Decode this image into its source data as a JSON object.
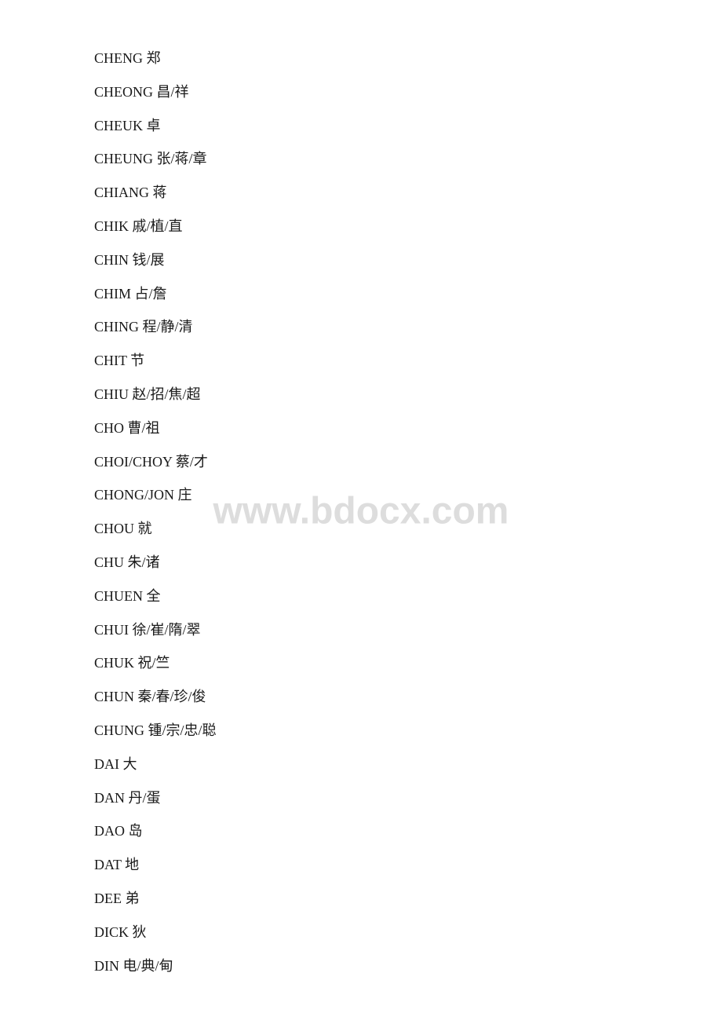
{
  "watermark": "www.bdocx.com",
  "entries": [
    {
      "id": "cheng",
      "text": "CHENG 郑"
    },
    {
      "id": "cheong",
      "text": "CHEONG 昌/祥"
    },
    {
      "id": "cheuk",
      "text": "CHEUK 卓"
    },
    {
      "id": "cheung",
      "text": "CHEUNG 张/蒋/章"
    },
    {
      "id": "chiang",
      "text": "CHIANG 蒋"
    },
    {
      "id": "chik",
      "text": "CHIK 戚/植/直"
    },
    {
      "id": "chin",
      "text": "CHIN 钱/展"
    },
    {
      "id": "chim",
      "text": "CHIM 占/詹"
    },
    {
      "id": "ching",
      "text": "CHING 程/静/清"
    },
    {
      "id": "chit",
      "text": "CHIT 节"
    },
    {
      "id": "chiu",
      "text": "CHIU 赵/招/焦/超"
    },
    {
      "id": "cho",
      "text": "CHO 曹/祖"
    },
    {
      "id": "choi-choy",
      "text": "CHOI/CHOY 蔡/才"
    },
    {
      "id": "chong-jon",
      "text": "CHONG/JON 庄"
    },
    {
      "id": "chou",
      "text": "CHOU 就"
    },
    {
      "id": "chu",
      "text": "CHU 朱/诸"
    },
    {
      "id": "chuen",
      "text": "CHUEN 全"
    },
    {
      "id": "chui",
      "text": "CHUI 徐/崔/隋/翠"
    },
    {
      "id": "chuk",
      "text": "CHUK 祝/竺"
    },
    {
      "id": "chun",
      "text": "CHUN 秦/春/珍/俊"
    },
    {
      "id": "chung",
      "text": "CHUNG 锺/宗/忠/聪"
    },
    {
      "id": "dai",
      "text": "DAI 大"
    },
    {
      "id": "dan",
      "text": "DAN 丹/蛋"
    },
    {
      "id": "dao",
      "text": "DAO 岛"
    },
    {
      "id": "dat",
      "text": "DAT 地"
    },
    {
      "id": "dee",
      "text": "DEE 弟"
    },
    {
      "id": "dick",
      "text": "DICK 狄"
    },
    {
      "id": "din",
      "text": "DIN 电/典/甸"
    }
  ]
}
